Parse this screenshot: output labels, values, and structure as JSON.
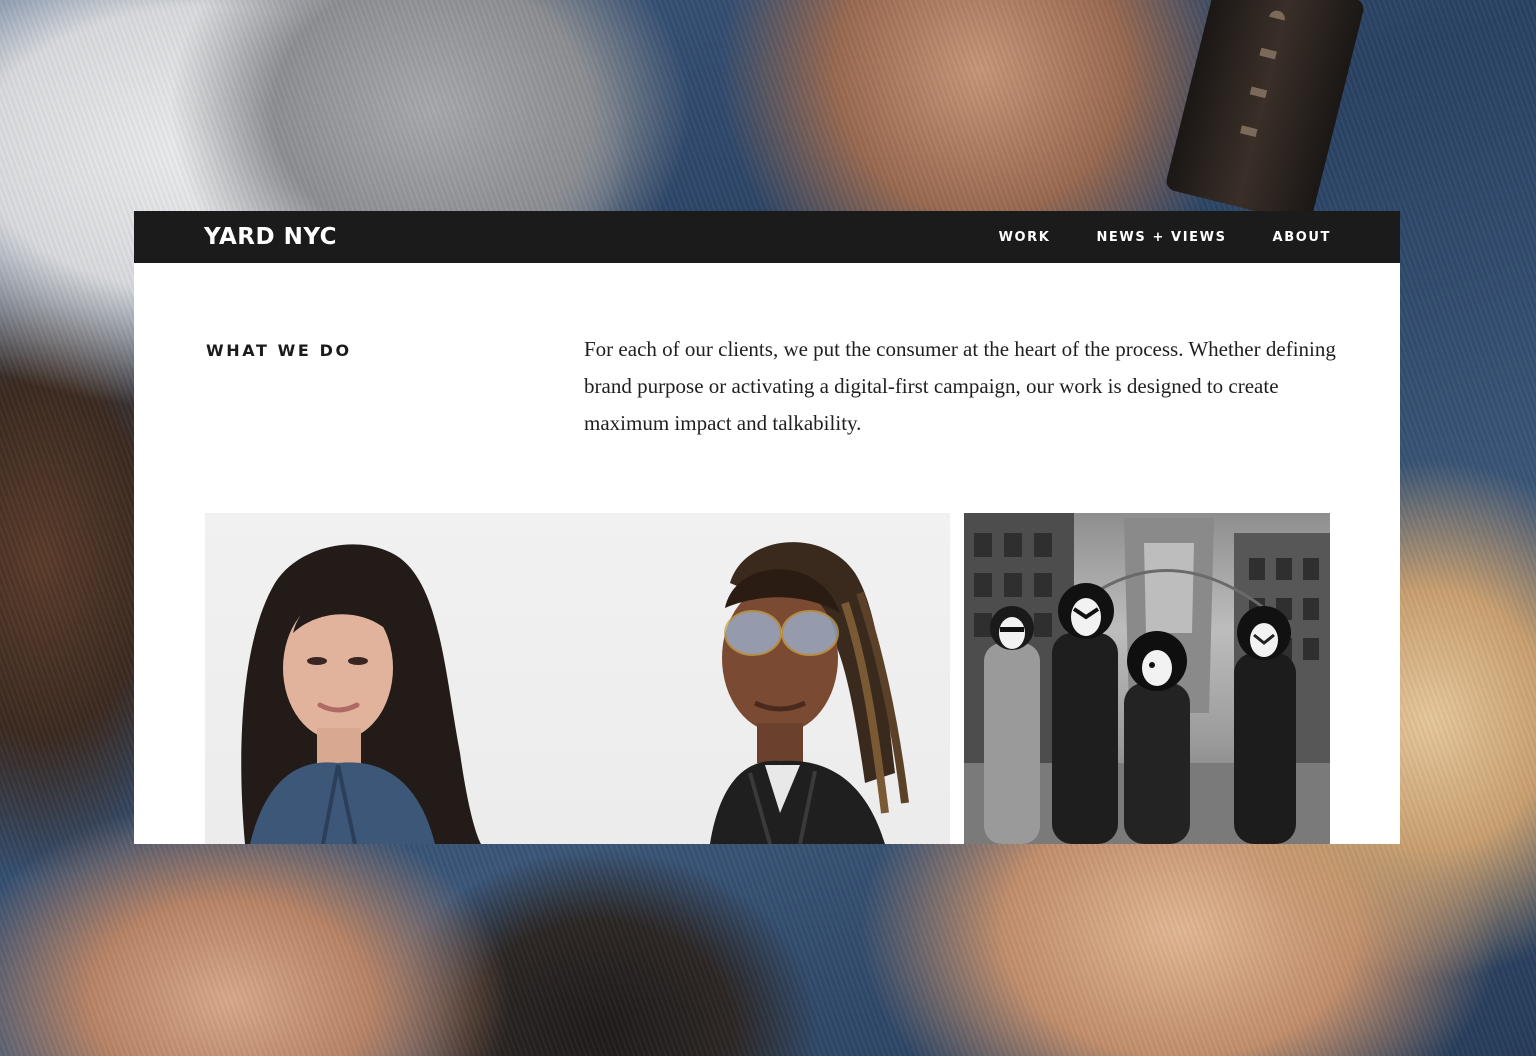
{
  "site": {
    "logo": "YARD NYC",
    "nav": [
      {
        "label": "WORK"
      },
      {
        "label": "NEWS + VIEWS"
      },
      {
        "label": "ABOUT"
      }
    ]
  },
  "intro_section": {
    "heading": "WHAT WE DO",
    "body": "For each of our clients, we put the consumer at the heart of the process. Whether defining brand purpose or activating a digital-first campaign, our work is designed to create maximum impact and talkability."
  },
  "work_tiles": [
    {
      "subject": "portrait-duo"
    },
    {
      "subject": "band-group"
    }
  ]
}
